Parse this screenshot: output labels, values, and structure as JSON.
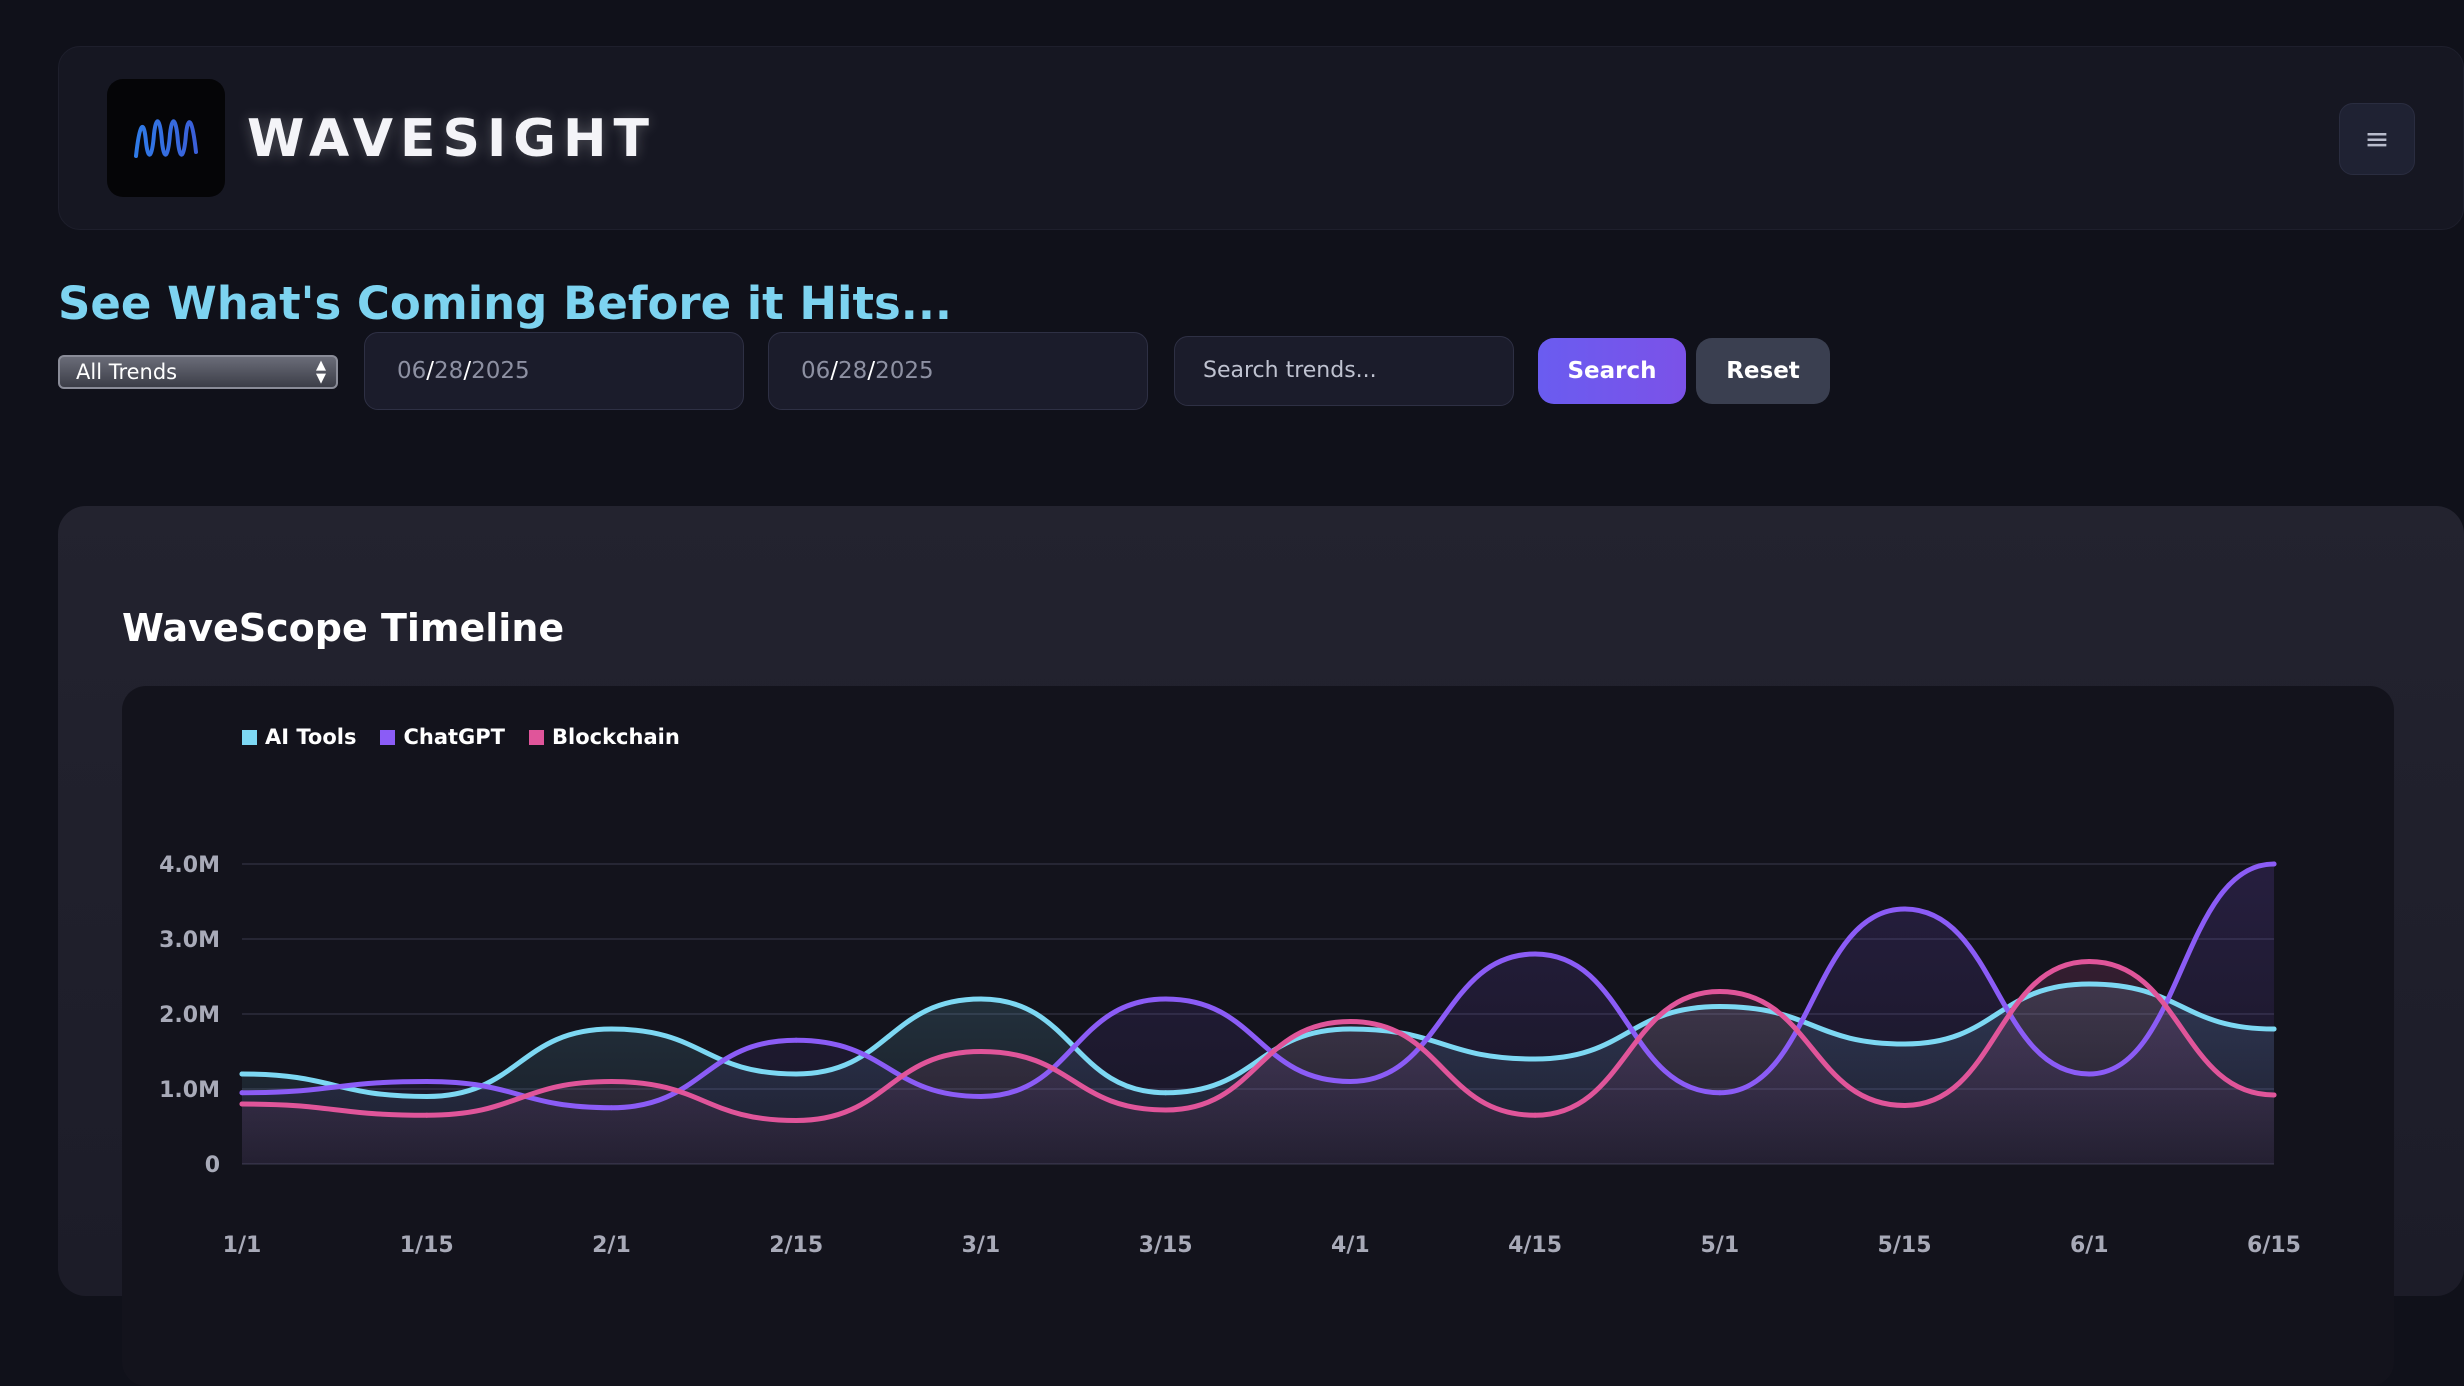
{
  "header": {
    "brand": "WAVESIGHT",
    "logo_icon": "wave-logo-icon",
    "menu_icon": "hamburger-menu-icon"
  },
  "tagline": "See What's Coming Before it Hits...",
  "filters": {
    "category_selected": "All Trends",
    "start_date": {
      "mm": "06",
      "dd": "28",
      "yyyy": "2025"
    },
    "end_date": {
      "mm": "06",
      "dd": "28",
      "yyyy": "2025"
    },
    "search_placeholder": "Search trends...",
    "search_label": "Search",
    "reset_label": "Reset"
  },
  "colors": {
    "accent": "#7dd3f0",
    "primary_button": "#6a5cf0",
    "ai_tools": "#7dd8f3",
    "chatgpt": "#8b5cf6",
    "blockchain": "#e0559a"
  },
  "chart_data": {
    "type": "line",
    "title": "WaveScope Timeline",
    "categories": [
      "1/1",
      "1/15",
      "2/1",
      "2/15",
      "3/1",
      "3/15",
      "4/1",
      "4/15",
      "5/1",
      "5/15",
      "6/1",
      "6/15"
    ],
    "y_ticks": [
      "0",
      "1.0M",
      "2.0M",
      "3.0M",
      "4.0M"
    ],
    "ylim": [
      0,
      4000000
    ],
    "grid": true,
    "legend_position": "top-left",
    "series": [
      {
        "name": "AI Tools",
        "color": "#7dd8f3",
        "values": [
          1200000,
          900000,
          1800000,
          1200000,
          2200000,
          950000,
          1800000,
          1400000,
          2100000,
          1600000,
          2400000,
          1800000
        ]
      },
      {
        "name": "ChatGPT",
        "color": "#8b5cf6",
        "values": [
          950000,
          1100000,
          750000,
          1650000,
          900000,
          2200000,
          1100000,
          2800000,
          950000,
          3400000,
          1200000,
          4000000
        ]
      },
      {
        "name": "Blockchain",
        "color": "#e0559a",
        "values": [
          800000,
          650000,
          1100000,
          580000,
          1500000,
          720000,
          1900000,
          650000,
          2300000,
          780000,
          2700000,
          920000
        ]
      }
    ]
  }
}
